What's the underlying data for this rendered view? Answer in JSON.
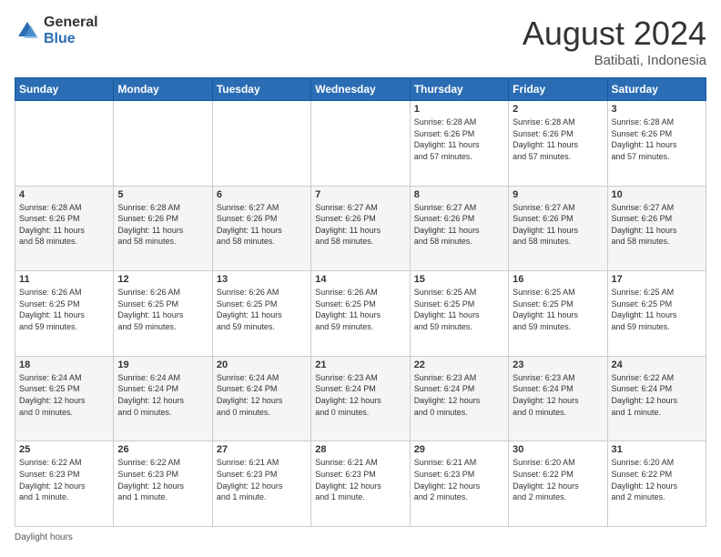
{
  "header": {
    "logo_general": "General",
    "logo_blue": "Blue",
    "month_year": "August 2024",
    "location": "Batibati, Indonesia"
  },
  "footer": {
    "daylight_label": "Daylight hours"
  },
  "weekdays": [
    "Sunday",
    "Monday",
    "Tuesday",
    "Wednesday",
    "Thursday",
    "Friday",
    "Saturday"
  ],
  "weeks": [
    [
      {
        "day": "",
        "info": ""
      },
      {
        "day": "",
        "info": ""
      },
      {
        "day": "",
        "info": ""
      },
      {
        "day": "",
        "info": ""
      },
      {
        "day": "1",
        "info": "Sunrise: 6:28 AM\nSunset: 6:26 PM\nDaylight: 11 hours\nand 57 minutes."
      },
      {
        "day": "2",
        "info": "Sunrise: 6:28 AM\nSunset: 6:26 PM\nDaylight: 11 hours\nand 57 minutes."
      },
      {
        "day": "3",
        "info": "Sunrise: 6:28 AM\nSunset: 6:26 PM\nDaylight: 11 hours\nand 57 minutes."
      }
    ],
    [
      {
        "day": "4",
        "info": "Sunrise: 6:28 AM\nSunset: 6:26 PM\nDaylight: 11 hours\nand 58 minutes."
      },
      {
        "day": "5",
        "info": "Sunrise: 6:28 AM\nSunset: 6:26 PM\nDaylight: 11 hours\nand 58 minutes."
      },
      {
        "day": "6",
        "info": "Sunrise: 6:27 AM\nSunset: 6:26 PM\nDaylight: 11 hours\nand 58 minutes."
      },
      {
        "day": "7",
        "info": "Sunrise: 6:27 AM\nSunset: 6:26 PM\nDaylight: 11 hours\nand 58 minutes."
      },
      {
        "day": "8",
        "info": "Sunrise: 6:27 AM\nSunset: 6:26 PM\nDaylight: 11 hours\nand 58 minutes."
      },
      {
        "day": "9",
        "info": "Sunrise: 6:27 AM\nSunset: 6:26 PM\nDaylight: 11 hours\nand 58 minutes."
      },
      {
        "day": "10",
        "info": "Sunrise: 6:27 AM\nSunset: 6:26 PM\nDaylight: 11 hours\nand 58 minutes."
      }
    ],
    [
      {
        "day": "11",
        "info": "Sunrise: 6:26 AM\nSunset: 6:25 PM\nDaylight: 11 hours\nand 59 minutes."
      },
      {
        "day": "12",
        "info": "Sunrise: 6:26 AM\nSunset: 6:25 PM\nDaylight: 11 hours\nand 59 minutes."
      },
      {
        "day": "13",
        "info": "Sunrise: 6:26 AM\nSunset: 6:25 PM\nDaylight: 11 hours\nand 59 minutes."
      },
      {
        "day": "14",
        "info": "Sunrise: 6:26 AM\nSunset: 6:25 PM\nDaylight: 11 hours\nand 59 minutes."
      },
      {
        "day": "15",
        "info": "Sunrise: 6:25 AM\nSunset: 6:25 PM\nDaylight: 11 hours\nand 59 minutes."
      },
      {
        "day": "16",
        "info": "Sunrise: 6:25 AM\nSunset: 6:25 PM\nDaylight: 11 hours\nand 59 minutes."
      },
      {
        "day": "17",
        "info": "Sunrise: 6:25 AM\nSunset: 6:25 PM\nDaylight: 11 hours\nand 59 minutes."
      }
    ],
    [
      {
        "day": "18",
        "info": "Sunrise: 6:24 AM\nSunset: 6:25 PM\nDaylight: 12 hours\nand 0 minutes."
      },
      {
        "day": "19",
        "info": "Sunrise: 6:24 AM\nSunset: 6:24 PM\nDaylight: 12 hours\nand 0 minutes."
      },
      {
        "day": "20",
        "info": "Sunrise: 6:24 AM\nSunset: 6:24 PM\nDaylight: 12 hours\nand 0 minutes."
      },
      {
        "day": "21",
        "info": "Sunrise: 6:23 AM\nSunset: 6:24 PM\nDaylight: 12 hours\nand 0 minutes."
      },
      {
        "day": "22",
        "info": "Sunrise: 6:23 AM\nSunset: 6:24 PM\nDaylight: 12 hours\nand 0 minutes."
      },
      {
        "day": "23",
        "info": "Sunrise: 6:23 AM\nSunset: 6:24 PM\nDaylight: 12 hours\nand 0 minutes."
      },
      {
        "day": "24",
        "info": "Sunrise: 6:22 AM\nSunset: 6:24 PM\nDaylight: 12 hours\nand 1 minute."
      }
    ],
    [
      {
        "day": "25",
        "info": "Sunrise: 6:22 AM\nSunset: 6:23 PM\nDaylight: 12 hours\nand 1 minute."
      },
      {
        "day": "26",
        "info": "Sunrise: 6:22 AM\nSunset: 6:23 PM\nDaylight: 12 hours\nand 1 minute."
      },
      {
        "day": "27",
        "info": "Sunrise: 6:21 AM\nSunset: 6:23 PM\nDaylight: 12 hours\nand 1 minute."
      },
      {
        "day": "28",
        "info": "Sunrise: 6:21 AM\nSunset: 6:23 PM\nDaylight: 12 hours\nand 1 minute."
      },
      {
        "day": "29",
        "info": "Sunrise: 6:21 AM\nSunset: 6:23 PM\nDaylight: 12 hours\nand 2 minutes."
      },
      {
        "day": "30",
        "info": "Sunrise: 6:20 AM\nSunset: 6:22 PM\nDaylight: 12 hours\nand 2 minutes."
      },
      {
        "day": "31",
        "info": "Sunrise: 6:20 AM\nSunset: 6:22 PM\nDaylight: 12 hours\nand 2 minutes."
      }
    ]
  ]
}
